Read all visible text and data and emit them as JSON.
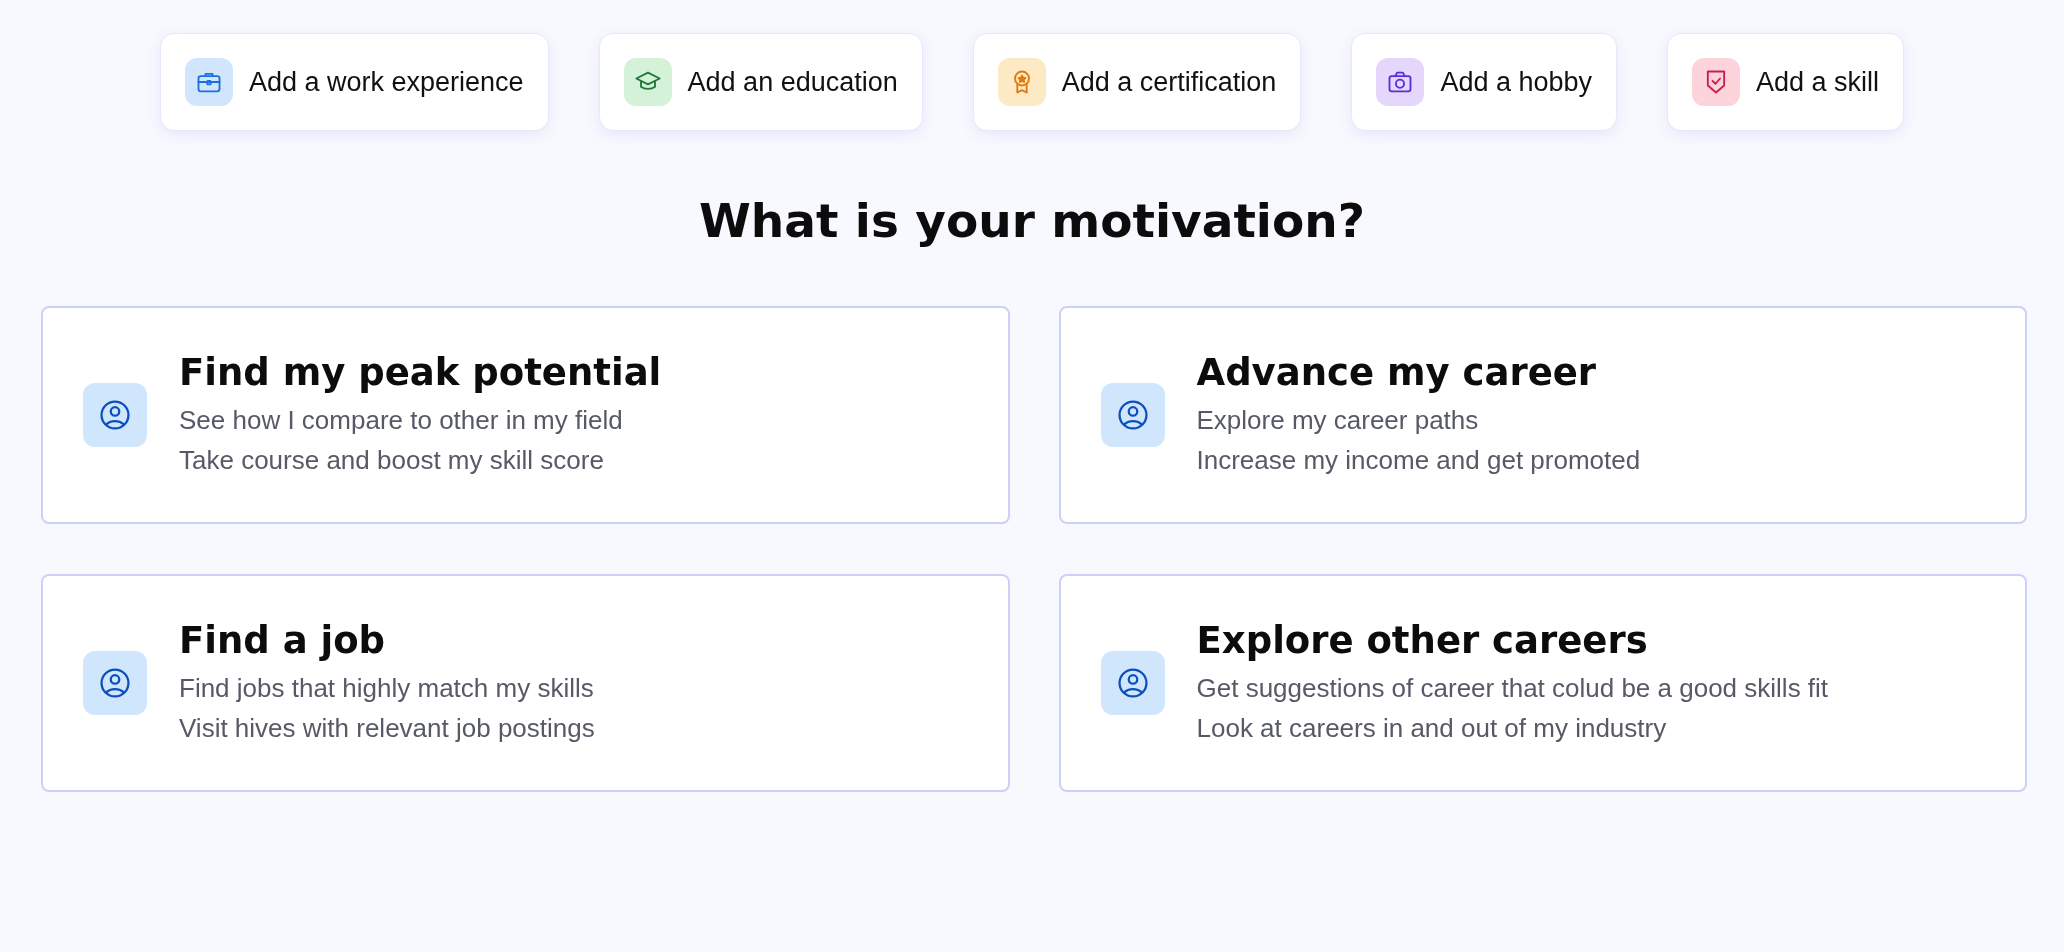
{
  "quick_add": [
    {
      "kind": "work",
      "label": "Add a work experience"
    },
    {
      "kind": "education",
      "label": "Add an education"
    },
    {
      "kind": "certification",
      "label": "Add a certification"
    },
    {
      "kind": "hobby",
      "label": "Add a hobby"
    },
    {
      "kind": "skill",
      "label": "Add a skill"
    }
  ],
  "heading": "What is your motivation?",
  "motivations": [
    {
      "title": "Find my peak potential",
      "lines": [
        "See how I compare to other in my field",
        "Take course and boost my skill score"
      ]
    },
    {
      "title": "Advance my career",
      "lines": [
        "Explore my career paths",
        "Increase my income and get promoted"
      ]
    },
    {
      "title": "Find a job",
      "lines": [
        "Find jobs that highly match my skills",
        "Visit hives with relevant job postings"
      ]
    },
    {
      "title": "Explore other careers",
      "lines": [
        "Get suggestions of career that colud be a good skills fit",
        "Look at careers in and out of my industry"
      ]
    }
  ]
}
